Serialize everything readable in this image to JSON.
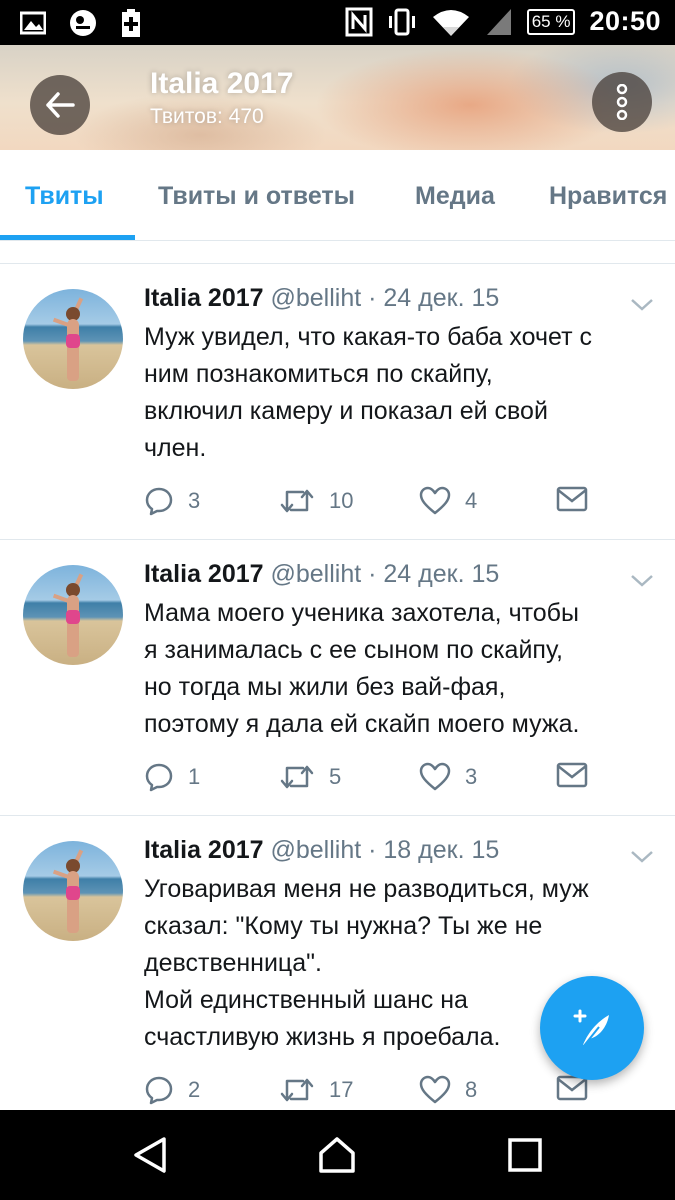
{
  "status_bar": {
    "battery": "65 %",
    "time": "20:50",
    "icons": [
      "gallery-icon",
      "app-notification-icon",
      "battery-plus-icon",
      "nfc-icon",
      "vibrate-icon",
      "wifi-icon",
      "signal-icon"
    ]
  },
  "header": {
    "title": "Italia 2017",
    "subtitle": "Твитов: 470"
  },
  "tabs": [
    {
      "label": "Твиты",
      "active": true
    },
    {
      "label": "Твиты и ответы",
      "active": false
    },
    {
      "label": "Медиа",
      "active": false
    },
    {
      "label": "Нравится",
      "active": false
    }
  ],
  "tweets": [
    {
      "name": "Italia 2017",
      "meta": "@belliht · 24 дек. 15",
      "text": "Муж увидел, что какая-то баба хочет с\nним познакомиться по скайпу,\nвключил камеру и показал ей свой\nчлен.",
      "replies": "3",
      "retweets": "10",
      "likes": "4"
    },
    {
      "name": "Italia 2017",
      "meta": "@belliht · 24 дек. 15",
      "text": "Мама моего ученика захотела, чтобы\nя занималась с ее сыном по скайпу,\nно тогда мы жили без вай-фая,\nпоэтому я дала ей скайп моего мужа.",
      "replies": "1",
      "retweets": "5",
      "likes": "3"
    },
    {
      "name": "Italia 2017",
      "meta": "@belliht · 18 дек. 15",
      "text": "Уговаривая меня не разводиться, муж\nсказал: \"Кому ты нужна? Ты же не\nдевственница\".\nМой единственный шанс на\nсчастливую жизнь я проебала.",
      "replies": "2",
      "retweets": "17",
      "likes": "8"
    }
  ],
  "colors": {
    "accent": "#1da1f2",
    "text": "#14171a",
    "muted": "#657786"
  }
}
